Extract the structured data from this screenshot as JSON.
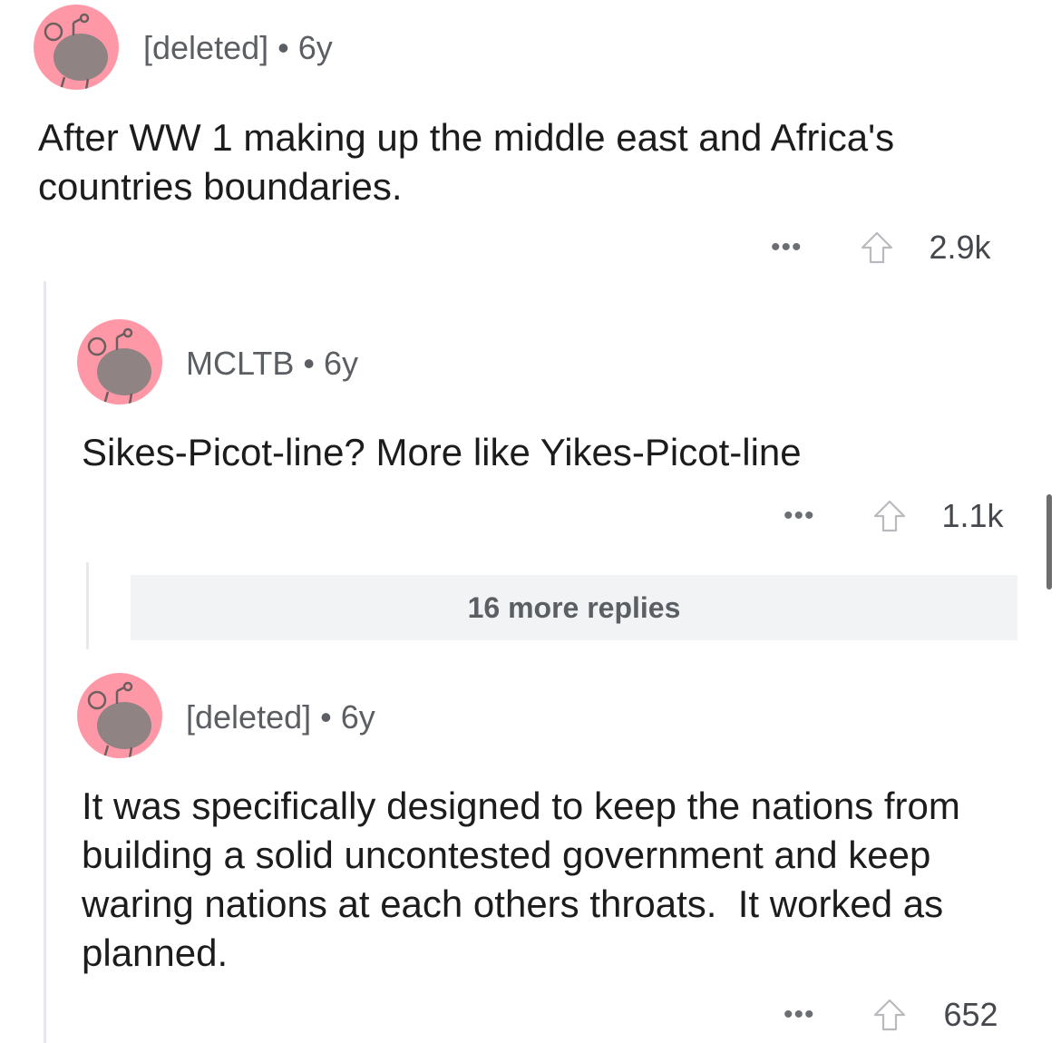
{
  "comments": [
    {
      "author": "[deleted]",
      "separator": "•",
      "age": "6y",
      "body": "After WW 1 making up the middle east and Africa's countries boundaries.",
      "more_label": "•••",
      "score": "2.9k"
    },
    {
      "author": "MCLTB",
      "separator": "•",
      "age": "6y",
      "body": "Sikes-Picot-line? More like Yikes-Picot-line",
      "more_label": "•••",
      "score": "1.1k"
    },
    {
      "author": "[deleted]",
      "separator": "•",
      "age": "6y",
      "body": "It was specifically designed to keep the nations from building a solid uncontested government and keep waring nations at each others throats.  It worked as planned.",
      "more_label": "•••",
      "score": "652"
    }
  ],
  "more_replies": {
    "label": "16 more replies"
  },
  "colors": {
    "avatar_bg": "#ff98a6",
    "snoo": "#8f8384",
    "meta_text": "#5b5e63",
    "thread_line": "#e6e8eb",
    "more_replies_bg": "#f1f3f5"
  },
  "icons": {
    "avatar": "snoo-avatar-icon",
    "upvote": "upvote-arrow-icon",
    "more": "more-options-icon"
  }
}
